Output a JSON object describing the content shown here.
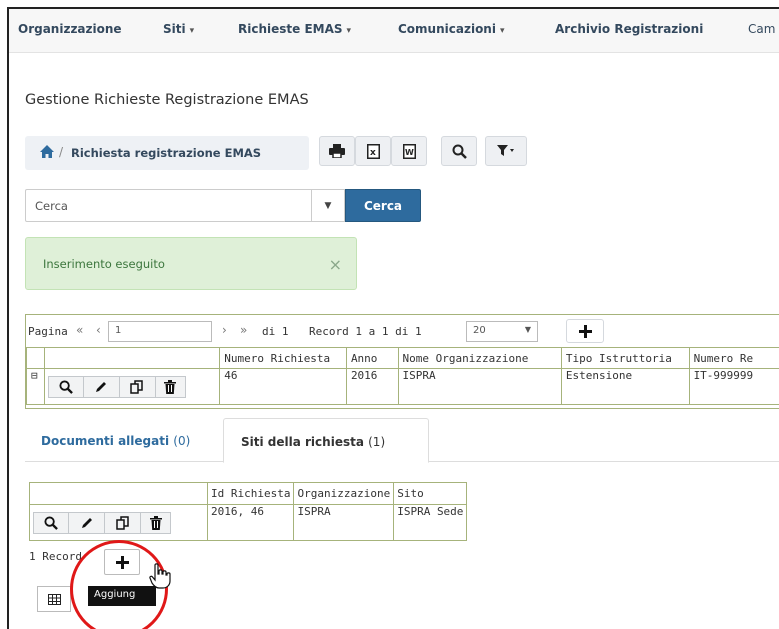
{
  "nav": {
    "items": [
      {
        "label": "Organizzazione",
        "caret": false
      },
      {
        "label": "Siti",
        "caret": true
      },
      {
        "label": "Richieste EMAS",
        "caret": true
      },
      {
        "label": "Comunicazioni",
        "caret": true
      },
      {
        "label": "Archivio Registrazioni",
        "caret": false
      },
      {
        "label": "Cam",
        "caret": false
      }
    ]
  },
  "page": {
    "title": "Gestione Richieste Registrazione EMAS"
  },
  "breadcrumb": {
    "label": "Richiesta registrazione EMAS"
  },
  "search": {
    "placeholder": "Cerca",
    "button": "Cerca"
  },
  "alert": {
    "message": "Inserimento eseguito",
    "close": "×"
  },
  "pager": {
    "pagina": "Pagina",
    "page_value": "1",
    "of": "di 1",
    "records": "Record 1 a 1 di 1",
    "page_size": "20"
  },
  "grid": {
    "columns": [
      "Numero Richiesta",
      "Anno",
      "Nome Organizzazione",
      "Tipo Istruttoria",
      "Numero Re"
    ],
    "rows": [
      {
        "expand": "⊟",
        "numero": "46",
        "anno": "2016",
        "nome": "ISPRA",
        "tipo": "Estensione",
        "numero_reg": "IT-999999"
      }
    ]
  },
  "tabs": {
    "documenti": {
      "label": "Documenti allegati",
      "count": "(0)"
    },
    "siti": {
      "label": "Siti della richiesta",
      "count": "(1)"
    }
  },
  "subgrid": {
    "columns": [
      "Id Richiesta",
      "Organizzazione",
      "Sito"
    ],
    "rows": [
      {
        "id": "2016, 46",
        "org": "ISPRA",
        "sito": "ISPRA Sede"
      }
    ]
  },
  "footer": {
    "record_count": "1 Record",
    "tooltip": "Aggiung"
  },
  "colors": {
    "accent": "#2e6b9e",
    "nav_text": "#34495e",
    "success_bg": "#dff0d8",
    "highlight": "#e01818"
  }
}
